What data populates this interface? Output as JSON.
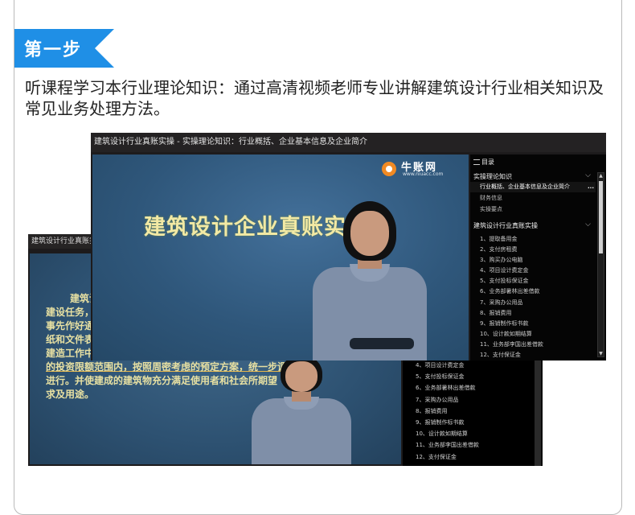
{
  "step": {
    "label": "第一步",
    "accent": "#1f8fe6"
  },
  "description": "听课程学习本行业理论知识：通过高清视频老师专业讲解建筑设计行业相关知识及常见业务处理方法。",
  "front_window": {
    "title": "建筑设计行业真账实操 - 实操理论知识：行业概括、企业基本信息及企业简介",
    "video_heading": "建筑设计企业真账实",
    "logo": {
      "name": "牛账网",
      "url": "www.niuacc.com"
    },
    "sidebar": {
      "header": "目录",
      "section1": {
        "title": "实操理论知识",
        "items": [
          {
            "label": "行业概括、企业基本信息及企业简介",
            "active": true,
            "more": "..."
          },
          {
            "label": "财务信息",
            "active": false
          },
          {
            "label": "实操要点",
            "active": false
          }
        ]
      },
      "section2": {
        "title": "建筑设计行业真账实操",
        "items": [
          "1、提取备用金",
          "2、支付房租费",
          "3、购买办公电脑",
          "4、项目设计费定金",
          "5、支付投标保证金",
          "6、业务部暑林出差借款",
          "7、采购办公用品",
          "8、报销费用",
          "9、报销制作标书款",
          "10、设计款如期结算",
          "11、业务部李国出差借款",
          "12、支付保证金"
        ]
      }
    }
  },
  "back_window": {
    "title": "建筑设计行业真账实操",
    "body_lines": [
      "建筑设",
      "建设任务，",
      "事先作好通",
      "纸和文件表",
      "建造工作中",
      "的投资限额范围内，按照周密考虑的预定方案，统一步调",
      "进行。并使建成的建筑物充分满足使用者和社会所期望",
      "求及用途。"
    ],
    "list": [
      "4、项目设计费定金",
      "5、支付投标保证金",
      "6、业务部暑林出差借款",
      "7、采购办公用品",
      "8、报销费用",
      "9、报销制作标书款",
      "10、设计款如期结算",
      "11、业务部李国出差借款",
      "12、支付保证金"
    ]
  }
}
